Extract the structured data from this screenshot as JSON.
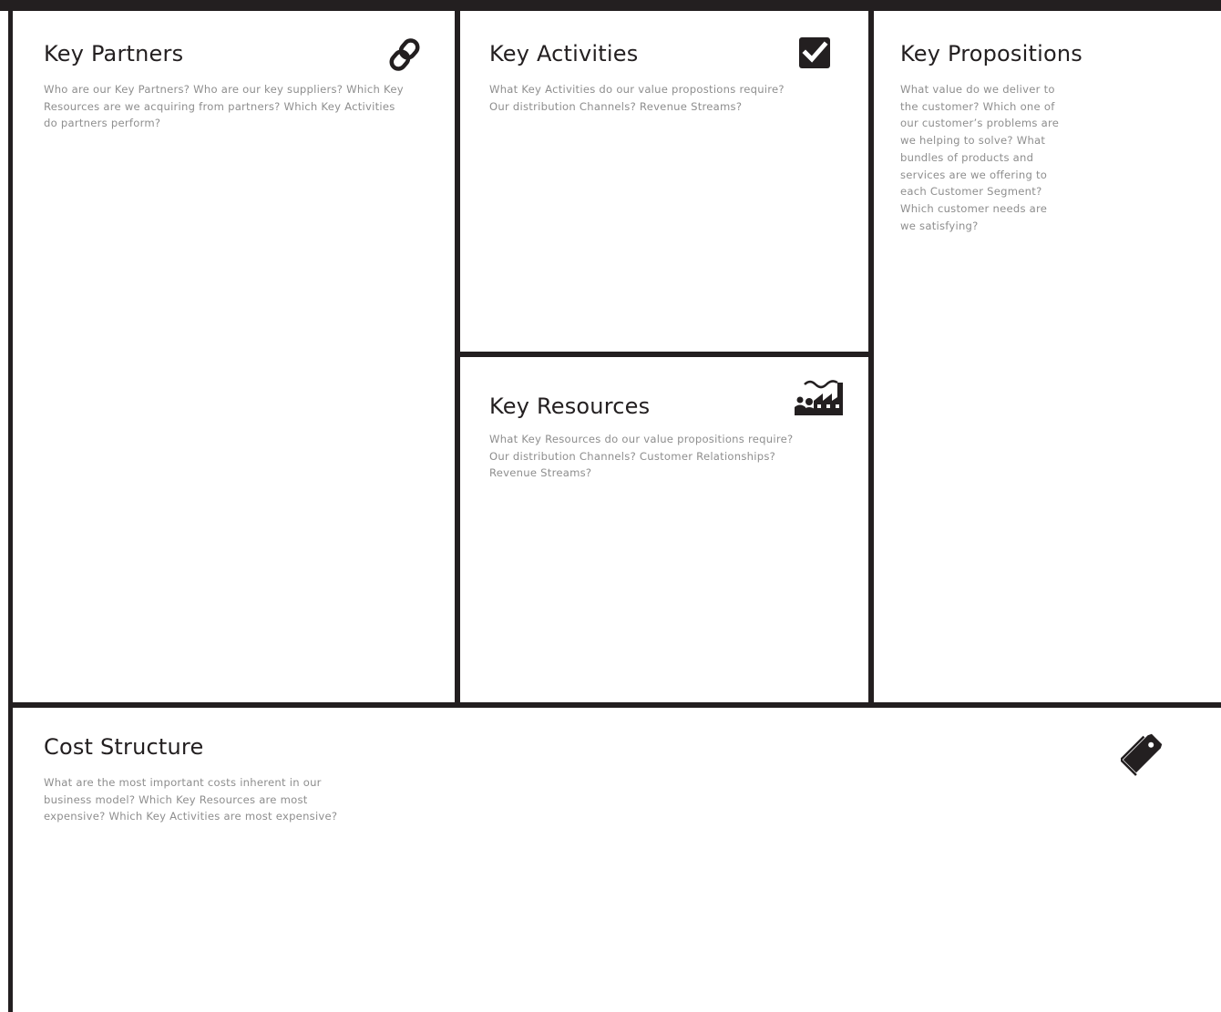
{
  "canvas": {
    "colors": {
      "border": "#231f20",
      "title": "#231f20",
      "description": "#8e8e8e",
      "background": "#ffffff"
    }
  },
  "blocks": {
    "key_partners": {
      "title": "Key Partners",
      "description_lines": [
        "Who are our Key Partners? Who are our key suppliers? Which Key",
        "Resources are we acquiring from partners? Which Key Activities",
        "do partners perform?"
      ],
      "icon": "link-icon"
    },
    "key_activities": {
      "title": "Key Activities",
      "description_lines": [
        "What Key Activities do our value propostions require?",
        "Our distribution Channels? Revenue Streams?"
      ],
      "icon": "checkbox-icon"
    },
    "key_propositions": {
      "title": "Key Propositions",
      "description_lines": [
        "What value do we deliver to",
        "the customer? Which one of",
        "our customer’s problems are",
        "we helping to solve? What",
        "bundles of products and",
        "services are we offering to",
        "each Customer Segment?",
        "Which customer needs are",
        "we satisfying?"
      ]
    },
    "key_resources": {
      "title": "Key Resources",
      "description_lines": [
        "What Key Resources do our value propositions require?",
        "Our distribution Channels? Customer Relationships?",
        "Revenue Streams?"
      ],
      "icon": "factory-workers-icon"
    },
    "cost_structure": {
      "title": "Cost Structure",
      "description_lines": [
        "What are the most important costs inherent in our",
        "business model? Which Key Resources are most",
        "expensive? Which Key Activities are most expensive?"
      ],
      "icon": "price-tag-icon"
    }
  }
}
